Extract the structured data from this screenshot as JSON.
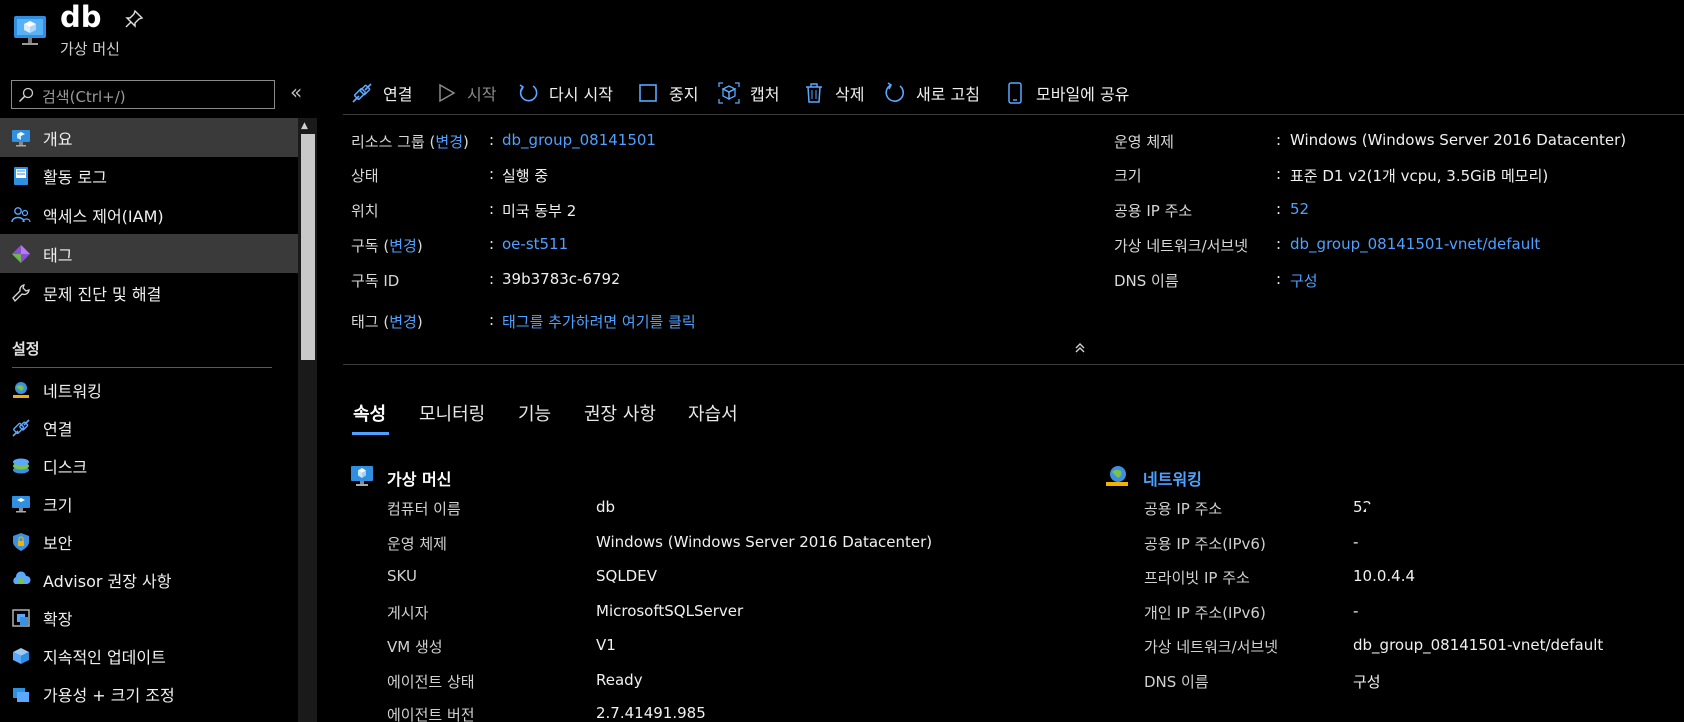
{
  "header": {
    "title": "db",
    "subtitle": "가상 머신",
    "icon": "virtual-machine-icon",
    "pin_icon": "pin-icon"
  },
  "sidebar": {
    "search_placeholder": "검색(Ctrl+/)",
    "collapse_glyph": "«",
    "items": [
      {
        "label": "개요",
        "icon": "overview-icon",
        "active": true
      },
      {
        "label": "활동 로그",
        "icon": "activity-log-icon"
      },
      {
        "label": "액세스 제어(IAM)",
        "icon": "iam-icon"
      },
      {
        "label": "태그",
        "icon": "tag-icon",
        "active": true
      },
      {
        "label": "문제 진단 및 해결",
        "icon": "wrench-icon"
      }
    ],
    "section_label": "설정",
    "settings_items": [
      {
        "label": "네트워킹",
        "icon": "networking-icon"
      },
      {
        "label": "연결",
        "icon": "connect-icon"
      },
      {
        "label": "디스크",
        "icon": "disk-icon"
      },
      {
        "label": "크기",
        "icon": "size-icon"
      },
      {
        "label": "보안",
        "icon": "security-icon"
      },
      {
        "label": "Advisor 권장 사항",
        "icon": "advisor-icon"
      },
      {
        "label": "확장",
        "icon": "extensions-icon"
      },
      {
        "label": "지속적인 업데이트",
        "icon": "continuous-update-icon"
      },
      {
        "label": "가용성 + 크기 조정",
        "icon": "availability-icon"
      }
    ]
  },
  "toolbar": {
    "connect": "연결",
    "start": "시작",
    "restart": "다시 시작",
    "stop": "중지",
    "capture": "캡처",
    "delete": "삭제",
    "refresh": "새로 고침",
    "share_mobile": "모바일에 공유"
  },
  "essentials": {
    "resource_group_label": "리소스 그룹",
    "change": "변경",
    "resource_group_value": "db_group_08141501",
    "status_label": "상태",
    "status_value": "실행 중",
    "location_label": "위치",
    "location_value": "미국 동부 2",
    "subscription_label": "구독",
    "subscription_value": "oe-st511",
    "subscription_id_label": "구독 ID",
    "subscription_id_value": "39b3783c-6792-",
    "tags_label": "태그",
    "tags_value": "태그를 추가하려면 여기를 클릭",
    "os_label": "운영 체제",
    "os_value": "Windows (Windows Server 2016 Datacenter)",
    "size_label": "크기",
    "size_value": "표준 D1 v2(1개 vcpu, 3.5GiB 메모리)",
    "public_ip_label": "공용 IP 주소",
    "public_ip_value": "52.",
    "vnet_label": "가상 네트워크/서브넷",
    "vnet_value": "db_group_08141501-vnet/default",
    "dns_label": "DNS 이름",
    "dns_value": "구성",
    "colon": ":"
  },
  "tabs": [
    "속성",
    "모니터링",
    "기능",
    "권장 사항",
    "자습서"
  ],
  "vm_section": {
    "title": "가상 머신",
    "rows": [
      {
        "label": "컴퓨터 이름",
        "value": "db"
      },
      {
        "label": "운영 체제",
        "value": "Windows (Windows Server 2016 Datacenter)"
      },
      {
        "label": "SKU",
        "value": "SQLDEV"
      },
      {
        "label": "게시자",
        "value": "MicrosoftSQLServer"
      },
      {
        "label": "VM 생성",
        "value": "V1"
      },
      {
        "label": "에이전트 상태",
        "value": "Ready"
      },
      {
        "label": "에이전트 버전",
        "value": "2.7.41491.985"
      }
    ]
  },
  "network_section": {
    "title": "네트워킹",
    "rows": [
      {
        "label": "공용 IP 주소",
        "value": "52."
      },
      {
        "label": "공용 IP 주소(IPv6)",
        "value": "-"
      },
      {
        "label": "프라이빗 IP 주소",
        "value": "10.0.4.4"
      },
      {
        "label": "개인 IP 주소(IPv6)",
        "value": "-"
      },
      {
        "label": "가상 네트워크/서브넷",
        "value": "db_group_08141501-vnet/default"
      },
      {
        "label": "DNS 이름",
        "value": "구성"
      }
    ]
  },
  "colors": {
    "accent": "#4ea1ff",
    "background": "#000000",
    "active_item": "#3a3a3a"
  }
}
